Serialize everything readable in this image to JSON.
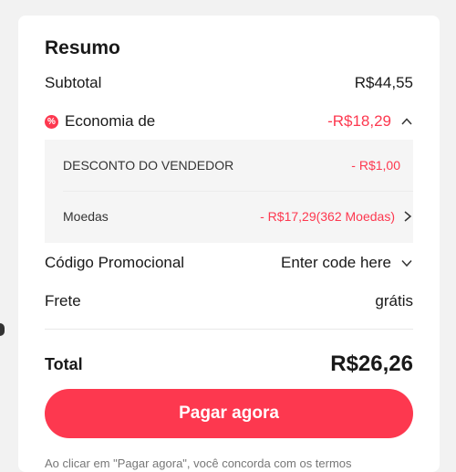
{
  "summary": {
    "title": "Resumo",
    "subtotal": {
      "label": "Subtotal",
      "value": "R$44,55"
    },
    "savings": {
      "label": "Economia de",
      "value": "-R$18,29",
      "icon": "discount-badge-icon",
      "items": [
        {
          "label": "DESCONTO DO VENDEDOR",
          "value": "- R$1,00"
        },
        {
          "label": "Moedas",
          "value": "- R$17,29(362 Moedas)"
        }
      ]
    },
    "promo": {
      "label": "Código Promocional",
      "value": "Enter code here"
    },
    "shipping": {
      "label": "Frete",
      "value": "grátis"
    },
    "total": {
      "label": "Total",
      "value": "R$26,26"
    },
    "pay_button": "Pagar agora",
    "footer_text": "Ao clicar em \"Pagar agora\", você concorda com os termos"
  },
  "colors": {
    "accent": "#fd384f",
    "text": "#191919",
    "background": "#f2f2f2"
  }
}
